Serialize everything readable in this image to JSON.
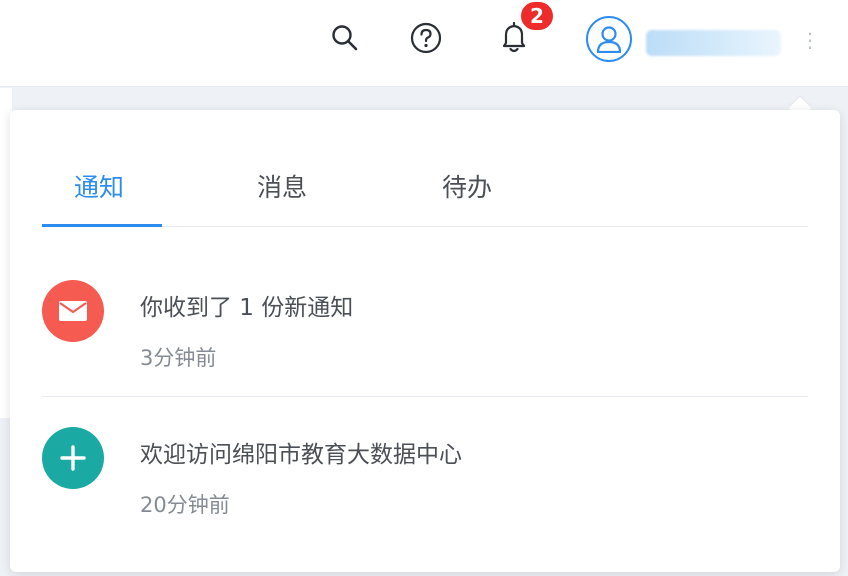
{
  "header": {
    "notification_count": "2",
    "icons": {
      "search": "search-icon",
      "help": "help-circle-icon",
      "bell": "bell-icon",
      "user": "user-icon"
    }
  },
  "notifications_panel": {
    "tabs": [
      {
        "label": "通知",
        "active": true
      },
      {
        "label": "消息",
        "active": false
      },
      {
        "label": "待办",
        "active": false
      }
    ],
    "items": [
      {
        "title": "你收到了 1 份新通知",
        "time": "3分钟前",
        "icon": "mail-icon",
        "icon_color": "#f65b52"
      },
      {
        "title": "欢迎访问绵阳市教育大数据中心",
        "time": "20分钟前",
        "icon": "plus-icon",
        "icon_color": "#1aa9a3"
      }
    ]
  },
  "colors": {
    "accent": "#2d8cf0",
    "badge": "#ee2b2b"
  }
}
